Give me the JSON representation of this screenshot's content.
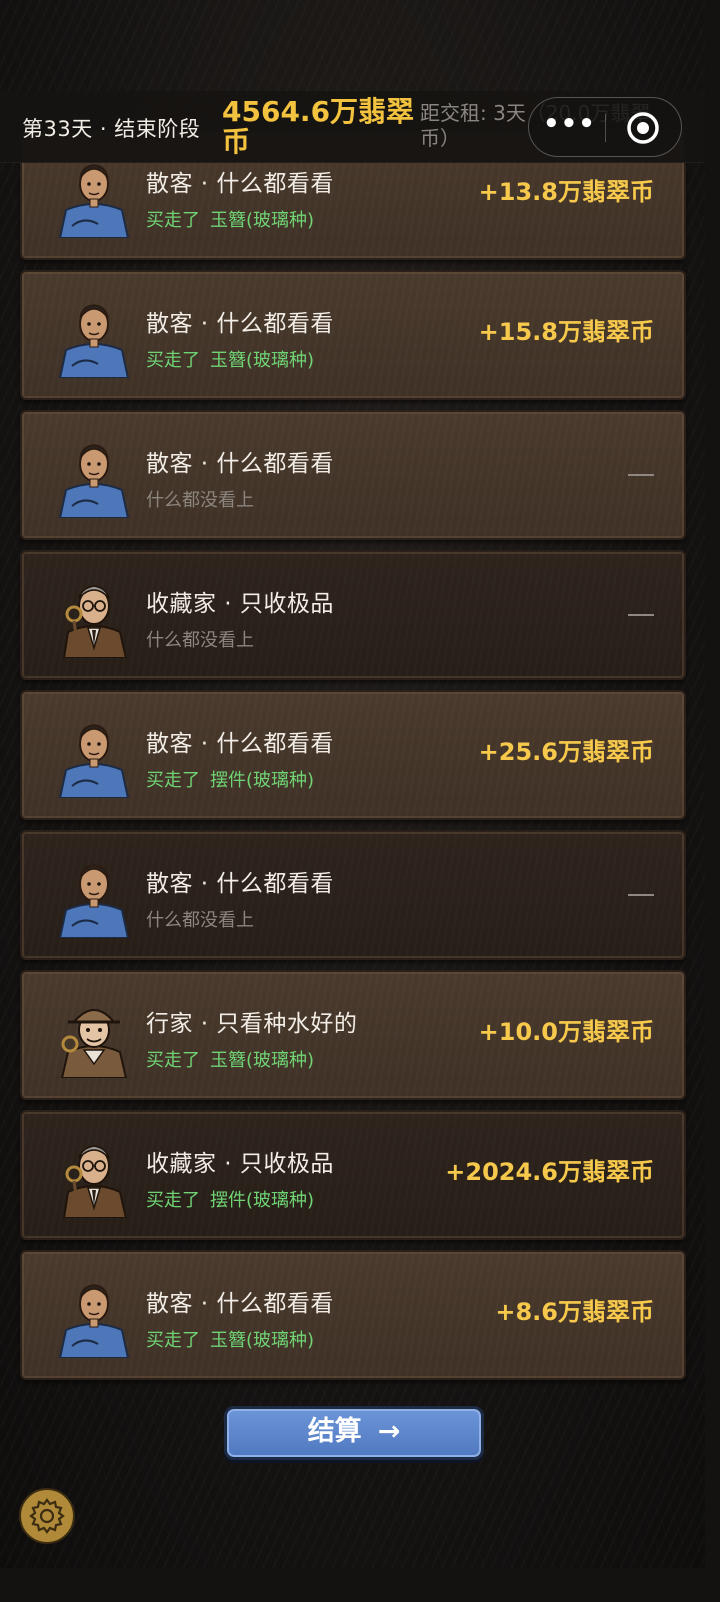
{
  "header": {
    "day_label": "第33天 · 结束阶段",
    "balance": "4564.6万翡翠币",
    "rent_countdown": "距交租: 3天（20.0万翡翠币）"
  },
  "capsule": {
    "more_icon": "more-dots-icon",
    "close_icon": "target-circle-icon"
  },
  "records": [
    {
      "customer": "散客 · 什么都看看",
      "avatar": "casual-customer",
      "status": "sold",
      "action": "买走了",
      "item": "玉簪(玻璃种)",
      "amount": "+13.8万翡翠币"
    },
    {
      "customer": "散客 · 什么都看看",
      "avatar": "casual-customer",
      "status": "sold",
      "action": "买走了",
      "item": "玉簪(玻璃种)",
      "amount": "+15.8万翡翠币"
    },
    {
      "customer": "散客 · 什么都看看",
      "avatar": "casual-customer",
      "status": "none",
      "action": "什么都没看上",
      "item": "",
      "amount": "—"
    },
    {
      "customer": "收藏家 · 只收极品",
      "avatar": "collector",
      "status": "none",
      "action": "什么都没看上",
      "item": "",
      "amount": "—"
    },
    {
      "customer": "散客 · 什么都看看",
      "avatar": "casual-customer",
      "status": "sold",
      "action": "买走了",
      "item": "摆件(玻璃种)",
      "amount": "+25.6万翡翠币"
    },
    {
      "customer": "散客 · 什么都看看",
      "avatar": "casual-customer",
      "status": "none",
      "action": "什么都没看上",
      "item": "",
      "amount": "—"
    },
    {
      "customer": "行家 · 只看种水好的",
      "avatar": "expert",
      "status": "sold",
      "action": "买走了",
      "item": "玉簪(玻璃种)",
      "amount": "+10.0万翡翠币"
    },
    {
      "customer": "收藏家 · 只收极品",
      "avatar": "collector",
      "status": "sold",
      "action": "买走了",
      "item": "摆件(玻璃种)",
      "amount": "+2024.6万翡翠币"
    },
    {
      "customer": "散客 · 什么都看看",
      "avatar": "casual-customer",
      "status": "sold",
      "action": "买走了",
      "item": "玉簪(玻璃种)",
      "amount": "+8.6万翡翠币"
    }
  ],
  "settle_button": {
    "label": "结算",
    "arrow": "→"
  },
  "settings_icon": "gear-icon",
  "colors": {
    "gold": "#f6c84b",
    "green": "#6fd374",
    "gray": "#8c857e",
    "button": "#5a84cc"
  }
}
